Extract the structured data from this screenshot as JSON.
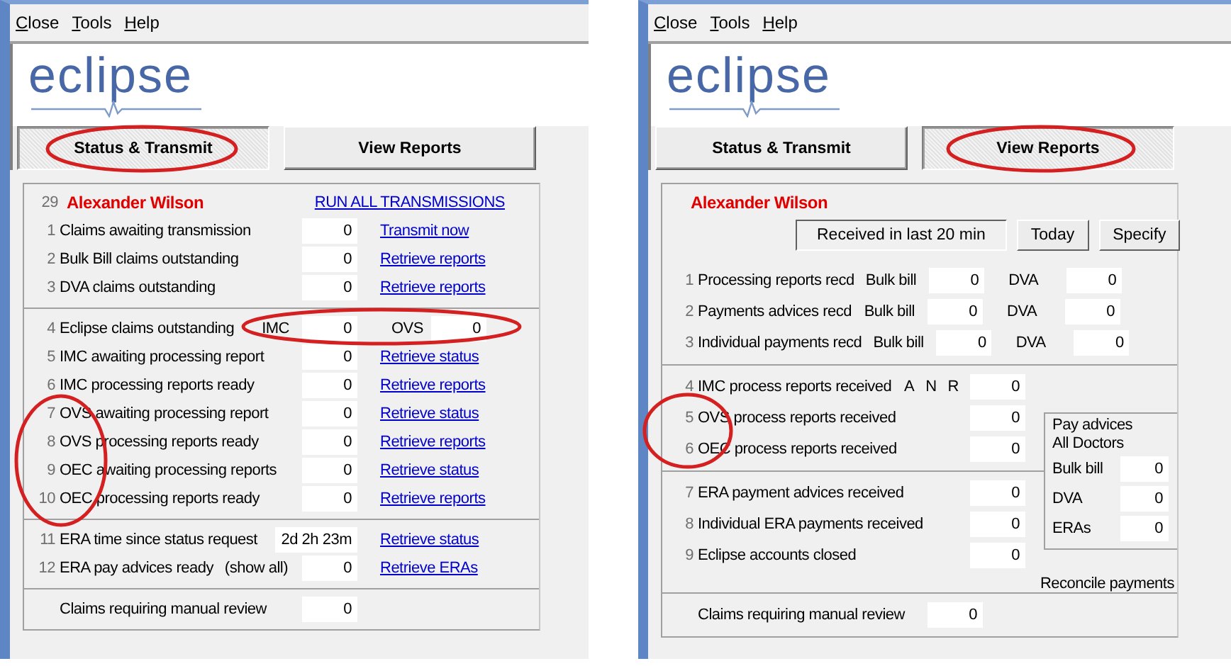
{
  "windows": [
    {
      "kind": "status",
      "menu": [
        "Close",
        "Tools",
        "Help"
      ],
      "logo": "eclipse",
      "tabs": [
        {
          "label": "Status & Transmit",
          "selected": true
        },
        {
          "label": "View Reports",
          "selected": false
        }
      ],
      "header": {
        "number": "29",
        "name": "Alexander Wilson",
        "link": "RUN ALL TRANSMISSIONS"
      },
      "sections": [
        {
          "rows": [
            {
              "number": "1",
              "label": "Claims awaiting transmission",
              "fields": [
                {
                  "value": "0"
                }
              ],
              "link": "Transmit now"
            },
            {
              "number": "2",
              "label": "Bulk Bill claims outstanding",
              "fields": [
                {
                  "value": "0"
                }
              ],
              "link": "Retrieve reports"
            },
            {
              "number": "3",
              "label": "DVA claims outstanding",
              "fields": [
                {
                  "value": "0"
                }
              ],
              "link": "Retrieve reports"
            }
          ]
        },
        {
          "rows": [
            {
              "number": "4",
              "label": "Eclipse claims outstanding",
              "fields": [
                {
                  "label": "IMC",
                  "value": "0"
                },
                {
                  "label": "OVS",
                  "value": "0"
                }
              ]
            },
            {
              "number": "5",
              "label": "IMC awaiting processing report",
              "fields": [
                {
                  "value": "0"
                }
              ],
              "link": "Retrieve status"
            },
            {
              "number": "6",
              "label": "IMC processing reports ready",
              "fields": [
                {
                  "value": "0"
                }
              ],
              "link": "Retrieve reports"
            },
            {
              "number": "7",
              "label": "OVS awaiting processing report",
              "fields": [
                {
                  "value": "0"
                }
              ],
              "link": "Retrieve status"
            },
            {
              "number": "8",
              "label": "OVS processing reports ready",
              "fields": [
                {
                  "value": "0"
                }
              ],
              "link": "Retrieve reports"
            },
            {
              "number": "9",
              "label": "OEC awaiting processing reports",
              "fields": [
                {
                  "value": "0"
                }
              ],
              "link": "Retrieve status"
            },
            {
              "number": "10",
              "label": "OEC processing reports ready",
              "fields": [
                {
                  "value": "0"
                }
              ],
              "link": "Retrieve reports"
            }
          ]
        },
        {
          "rows": [
            {
              "number": "11",
              "label": "ERA time since status request",
              "fields": [
                {
                  "value": "2d 2h 23m"
                }
              ],
              "link": "Retrieve status"
            },
            {
              "number": "12",
              "label": "ERA pay advices ready",
              "note": "(show all)",
              "fields": [
                {
                  "value": "0"
                }
              ],
              "link": "Retrieve ERAs"
            }
          ]
        },
        {
          "rows": [
            {
              "label": "Claims requiring manual review",
              "fields": [
                {
                  "value": "0"
                }
              ]
            }
          ]
        }
      ]
    },
    {
      "kind": "reports",
      "menu": [
        "Close",
        "Tools",
        "Help"
      ],
      "logo": "eclipse",
      "tabs": [
        {
          "label": "Status & Transmit",
          "selected": false
        },
        {
          "label": "View Reports",
          "selected": true
        }
      ],
      "header": {
        "name": "Alexander Wilson"
      },
      "filters": [
        {
          "label": "Received in last 20 min",
          "selected": true
        },
        {
          "label": "Today",
          "selected": false
        },
        {
          "label": "Specify",
          "selected": false
        }
      ],
      "sections": [
        {
          "rows": [
            {
              "number": "1",
              "label": "Processing reports recd",
              "fields": [
                {
                  "label": "Bulk bill",
                  "value": "0"
                },
                {
                  "label": "DVA",
                  "value": "0"
                }
              ]
            },
            {
              "number": "2",
              "label": "Payments advices recd",
              "fields": [
                {
                  "label": "Bulk bill",
                  "value": "0"
                },
                {
                  "label": "DVA",
                  "value": "0"
                }
              ]
            },
            {
              "number": "3",
              "label": "Individual payments recd",
              "fields": [
                {
                  "label": "Bulk bill",
                  "value": "0"
                },
                {
                  "label": "DVA",
                  "value": "0"
                }
              ]
            }
          ]
        },
        {
          "rows": [
            {
              "number": "4",
              "label": "IMC process reports received",
              "flags": [
                "A",
                "N",
                "R"
              ],
              "fields": [
                {
                  "value": "0"
                }
              ]
            },
            {
              "number": "5",
              "label": "OVS process reports received",
              "fields": [
                {
                  "value": "0"
                }
              ]
            },
            {
              "number": "6",
              "label": "OEC process reports received",
              "fields": [
                {
                  "value": "0"
                }
              ]
            }
          ]
        },
        {
          "rows": [
            {
              "number": "7",
              "label": "ERA payment advices received",
              "fields": [
                {
                  "value": "0"
                }
              ]
            },
            {
              "number": "8",
              "label": "Individual ERA payments received",
              "fields": [
                {
                  "value": "0"
                }
              ]
            },
            {
              "number": "9",
              "label": "Eclipse accounts closed",
              "fields": [
                {
                  "value": "0"
                }
              ]
            }
          ]
        },
        {
          "rows": [
            {
              "label": "Claims requiring manual review",
              "fields": [
                {
                  "value": "0"
                }
              ]
            }
          ]
        }
      ],
      "pay_advices": {
        "title": [
          "Pay advices",
          "All Doctors"
        ],
        "rows": [
          {
            "label": "Bulk bill",
            "value": "0"
          },
          {
            "label": "DVA",
            "value": "0"
          },
          {
            "label": "ERAs",
            "value": "0"
          }
        ]
      },
      "reconcile": "Reconcile payments"
    }
  ]
}
